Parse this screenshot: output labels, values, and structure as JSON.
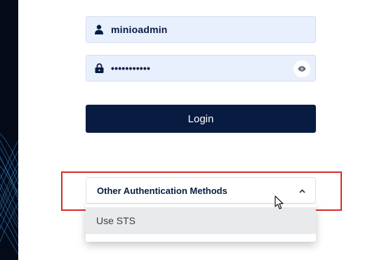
{
  "form": {
    "username_value": "minioadmin",
    "password_value": "•••••••••••",
    "login_label": "Login"
  },
  "other_auth": {
    "label": "Other Authentication Methods",
    "expanded": true,
    "options": [
      "Use STS"
    ]
  },
  "icons": {
    "username": "user-icon",
    "password": "lock-icon",
    "show_password": "eye-icon",
    "expand": "chevron-up-icon"
  },
  "colors": {
    "primary": "#081c42",
    "field_bg": "#e8effd",
    "highlight": "#d92b2b",
    "option_hover": "#e8eaec"
  }
}
